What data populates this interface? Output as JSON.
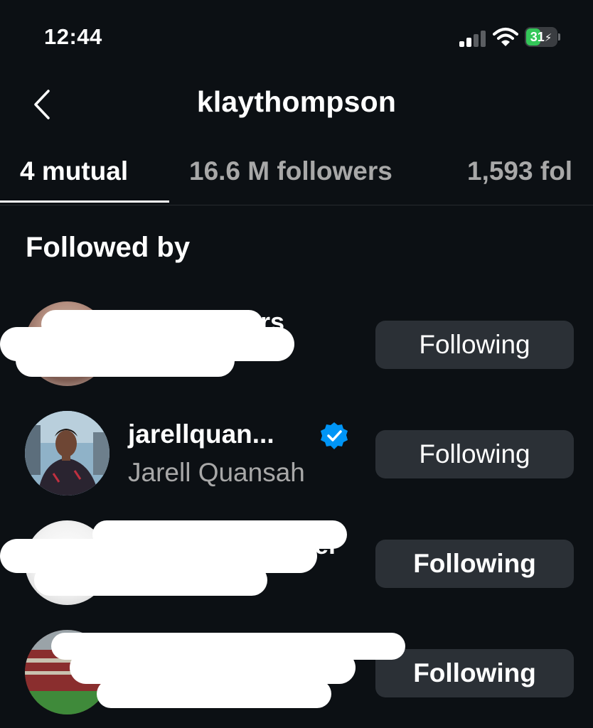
{
  "status_bar": {
    "time": "12:44",
    "battery_percent": "31",
    "battery_charging": true,
    "icons": [
      "cellular-signal-icon",
      "wifi-icon",
      "battery-icon"
    ]
  },
  "header": {
    "title": "klaythompson",
    "back_icon": "chevron-left-icon"
  },
  "tabs": [
    {
      "label": "4 mutual",
      "active": true
    },
    {
      "label": "16.6 M followers",
      "active": false
    },
    {
      "label": "1,593 fol",
      "active": false
    }
  ],
  "section_title": "Followed by",
  "accounts": [
    {
      "username": "",
      "full_name": "",
      "redacted": true,
      "button_label": "Following"
    },
    {
      "username": "jarellquan...",
      "full_name": "Jarell Quansah",
      "verified": true,
      "redacted": false,
      "button_label": "Following"
    },
    {
      "username": "",
      "full_name": "",
      "redacted": true,
      "button_label": "Following"
    },
    {
      "username": "",
      "full_name": "",
      "redacted": true,
      "button_label": "Following"
    }
  ],
  "colors": {
    "background": "#0c1014",
    "button_bg": "#2b3036",
    "muted_text": "#a8a8a8",
    "verified_blue": "#0095f6",
    "battery_green": "#34c759"
  }
}
